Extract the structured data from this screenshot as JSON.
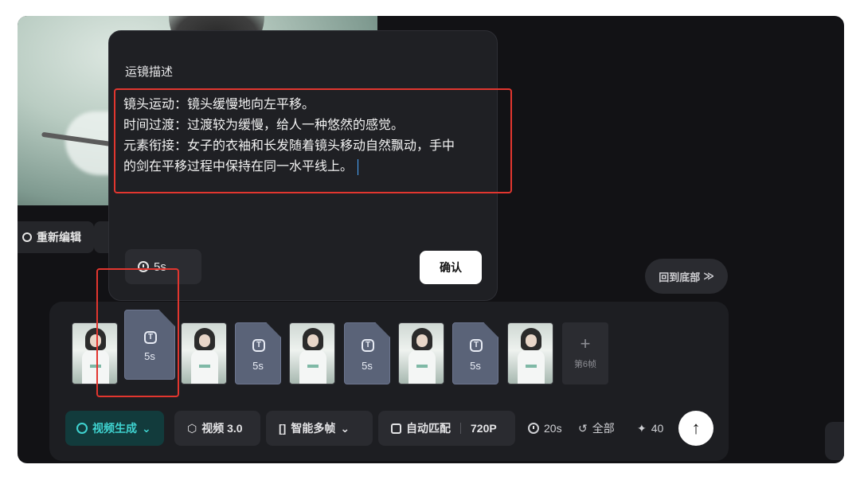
{
  "popup": {
    "title": "运镜描述",
    "lines": [
      "镜头运动：镜头缓慢地向左平移。",
      "时间过渡：过渡较为缓慢，给人一种悠然的感觉。",
      "元素衔接：女子的衣袖和长发随着镜头移动自然飘动，手中",
      "的剑在平移过程中保持在同一水平线上。"
    ],
    "duration": "5s",
    "confirm_label": "确认"
  },
  "reedit_label": "重新编辑",
  "back_bottom_label": "回到底部",
  "timeline": {
    "transitions": [
      "5s",
      "5s",
      "5s",
      "5s"
    ],
    "add_frame_label": "第6帧"
  },
  "toolbar": {
    "mode_label": "视频生成",
    "model_label": "视频 3.0",
    "multi_label": "智能多帧",
    "match_label": "自动匹配",
    "resolution": "720P",
    "total_duration": "20s",
    "scope_label": "全部",
    "credits": "40"
  },
  "colors": {
    "accent": "#3fd3d0",
    "highlight": "#e2362f"
  },
  "icons": [
    "refresh-icon",
    "clock-icon",
    "text-icon",
    "plus-icon",
    "cube-icon",
    "frames-icon",
    "aspect-icon",
    "undo-icon",
    "sparkle-icon",
    "arrow-up-icon"
  ]
}
